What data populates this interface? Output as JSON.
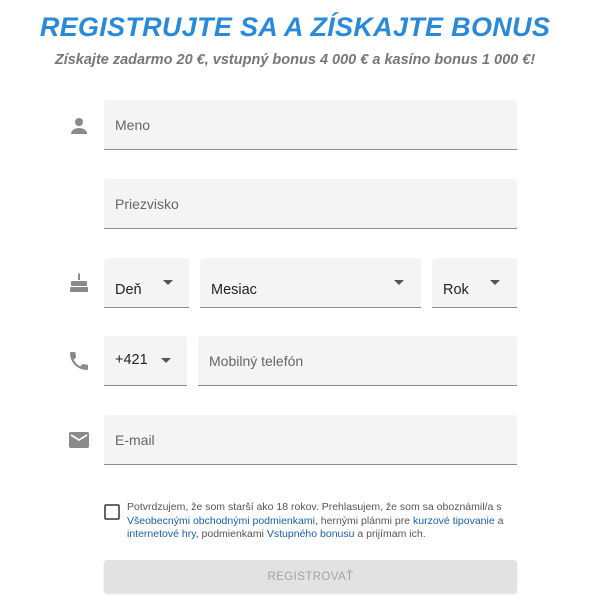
{
  "header": {
    "title": "REGISTRUJTE SA A ZÍSKAJTE BONUS",
    "subtitle": "Získajte zadarmo 20 €, vstupný bonus 4 000 € a kasíno bonus 1 000 €!"
  },
  "form": {
    "first_name": {
      "placeholder": "Meno"
    },
    "last_name": {
      "placeholder": "Priezvisko"
    },
    "birth_day": {
      "value": "Deň"
    },
    "birth_month": {
      "value": "Mesiac"
    },
    "birth_year": {
      "value": "Rok"
    },
    "phone_prefix": {
      "value": "+421"
    },
    "phone": {
      "placeholder": "Mobilný telefón"
    },
    "email": {
      "placeholder": "E-mail"
    },
    "consent": {
      "text_1": "Potvrdzujem, že som starší ako 18 rokov. Prehlasujem, že som sa oboznámil/a s ",
      "link_terms": "Všeobecnými obchodnými podmienkami",
      "text_2": ", hernými plánmi pre ",
      "link_betting": "kurzové tipovanie",
      "text_3": " a ",
      "link_games": "internetové hry",
      "text_4": ", podmienkami ",
      "link_bonus": "Vstupného bonusu",
      "text_5": " a prijímam ich."
    },
    "submit_label": "REGISTROVAŤ"
  },
  "icons": {
    "person": "person-icon",
    "cake": "cake-icon",
    "phone": "phone-icon",
    "email": "email-icon"
  },
  "colors": {
    "accent": "#2a8ad8",
    "link": "#1a5fa6",
    "field_bg": "#f4f4f4",
    "icon": "#8a8a8a",
    "button_disabled": "#e2e2e2"
  }
}
